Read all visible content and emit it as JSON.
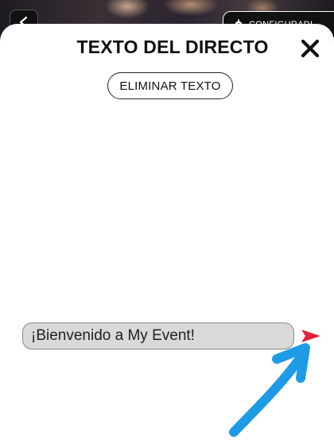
{
  "background": {
    "back_icon": "chevron-left-icon",
    "settings_button": {
      "icon": "gear-icon",
      "label": "CONFIGURADI"
    }
  },
  "modal": {
    "title": "TEXTO DEL DIRECTO",
    "close_icon": "close-icon",
    "clear_button_label": "ELIMINAR TEXTO",
    "input": {
      "value": "¡Bienvenido a My Event!"
    },
    "send_icon": "send-icon"
  },
  "annotation": {
    "icon": "pointer-arrow-icon",
    "color": "#1e9be6"
  },
  "colors": {
    "send": "#e3213b",
    "close": "#111111",
    "input_bg": "#d9d9d9"
  }
}
